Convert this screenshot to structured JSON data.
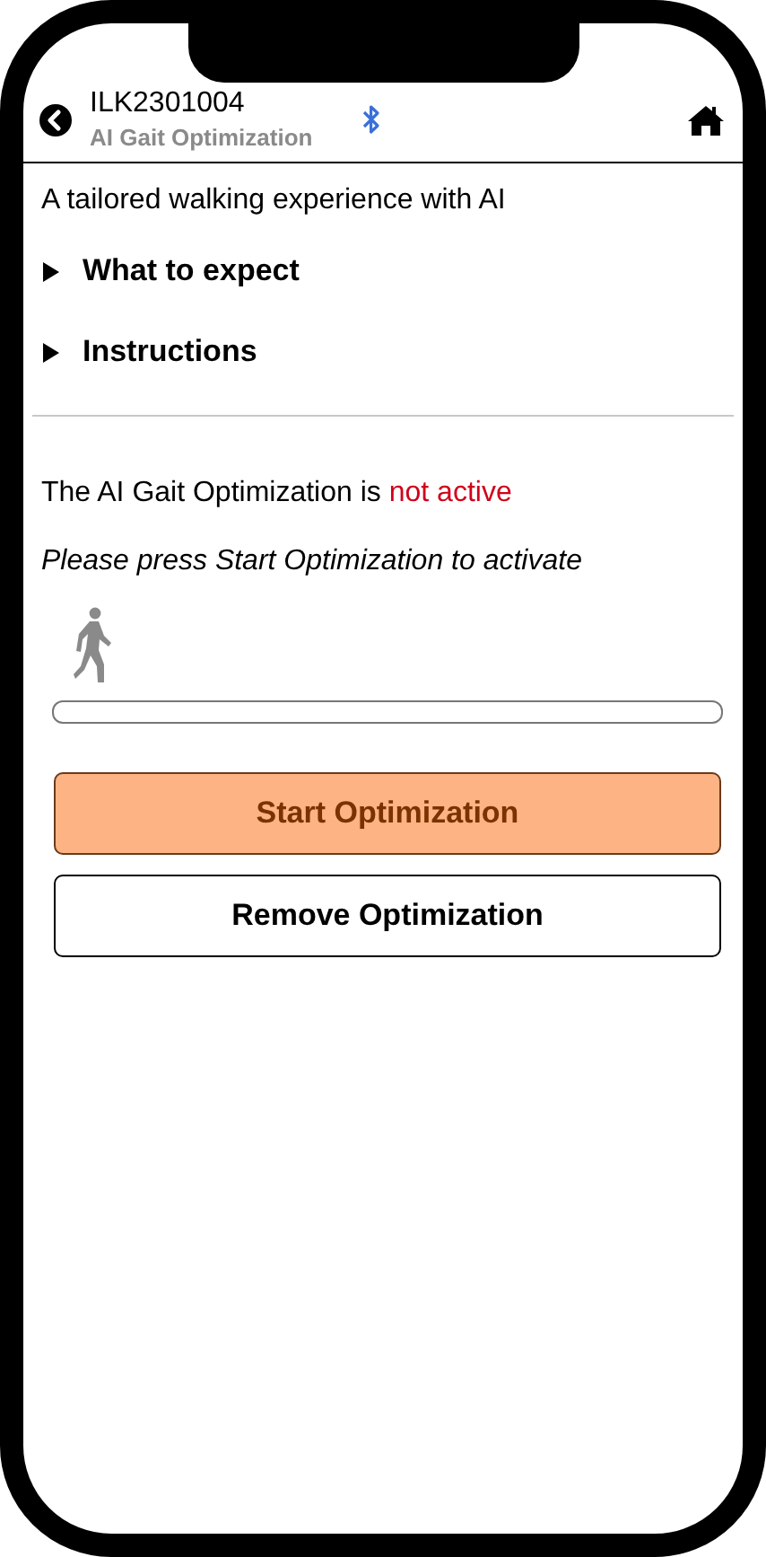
{
  "header": {
    "title": "ILK2301004",
    "subtitle": "AI Gait Optimization",
    "bluetooth_connected": true
  },
  "intro": "A tailored walking experience with AI",
  "sections": [
    {
      "label": "What to expect",
      "expanded": false
    },
    {
      "label": "Instructions",
      "expanded": false
    }
  ],
  "status": {
    "label": "The AI Gait Optimization is",
    "value": "not active",
    "active": false
  },
  "hint": "Please press Start Optimization to activate",
  "progress": {
    "level": 0
  },
  "buttons": [
    {
      "label": "Start Optimization",
      "kind": "primary"
    },
    {
      "label": "Remove Optimization",
      "kind": "secondary"
    }
  ]
}
